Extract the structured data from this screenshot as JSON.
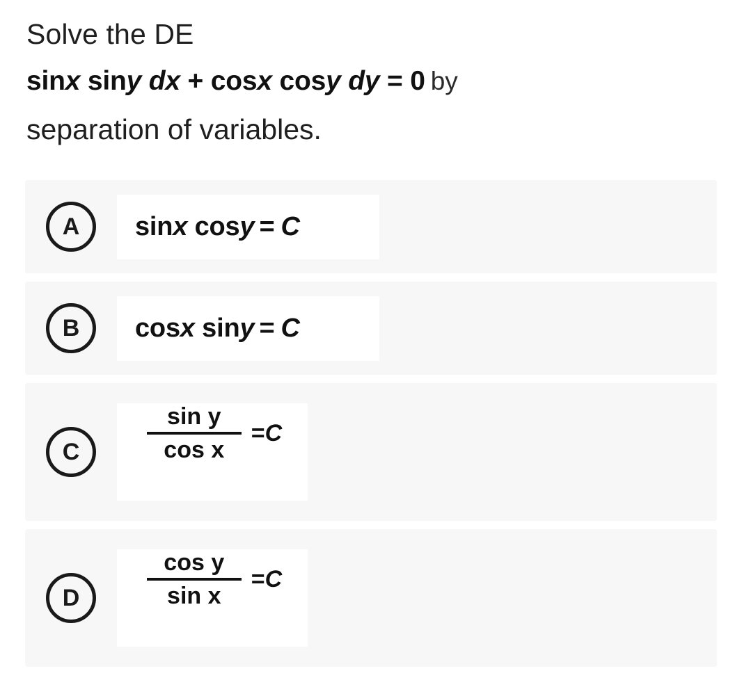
{
  "question": {
    "line1": "Solve the DE",
    "equation_prefix": "sin",
    "equation_full": "sinx siny dx + cosx cosy dy = 0",
    "equation_parts": {
      "sin1": "sin",
      "var_x1": "x",
      "sin2": " sin",
      "var_y1": "y",
      "dx": " dx",
      "plus": " + ",
      "cos1": "cos",
      "var_x2": "x",
      "cos2": " cos",
      "var_y2": "y",
      "dy": " dy",
      "equals": " = ",
      "zero": "0"
    },
    "tail": "by",
    "line3": "separation of variables."
  },
  "options": [
    {
      "marker": "A",
      "type": "inline",
      "expr_text": "sinx cosy = C",
      "parts": {
        "fn1": "sin",
        "v1": "x",
        "fn2": " cos",
        "v2": "y",
        "equals": "=",
        "constant": "C"
      }
    },
    {
      "marker": "B",
      "type": "inline",
      "expr_text": "cosx siny = C",
      "parts": {
        "fn1": "cos",
        "v1": "x",
        "fn2": " sin",
        "v2": "y",
        "equals": "=",
        "constant": "C"
      }
    },
    {
      "marker": "C",
      "type": "fraction",
      "expr_text": "sin y / cos x = C",
      "parts": {
        "numerator": "sin y",
        "denominator": "cos x",
        "equals": "=",
        "constant": "C"
      }
    },
    {
      "marker": "D",
      "type": "fraction",
      "expr_text": "cos y / sin x = C",
      "parts": {
        "numerator": "cos y",
        "denominator": "sin x",
        "equals": "=",
        "constant": "C"
      }
    }
  ],
  "colors": {
    "page_background": "#ffffff",
    "row_background": "#f7f7f7",
    "formula_background": "#ffffff",
    "text": "#1b1b1b",
    "marker_border": "#1a1a1a"
  }
}
